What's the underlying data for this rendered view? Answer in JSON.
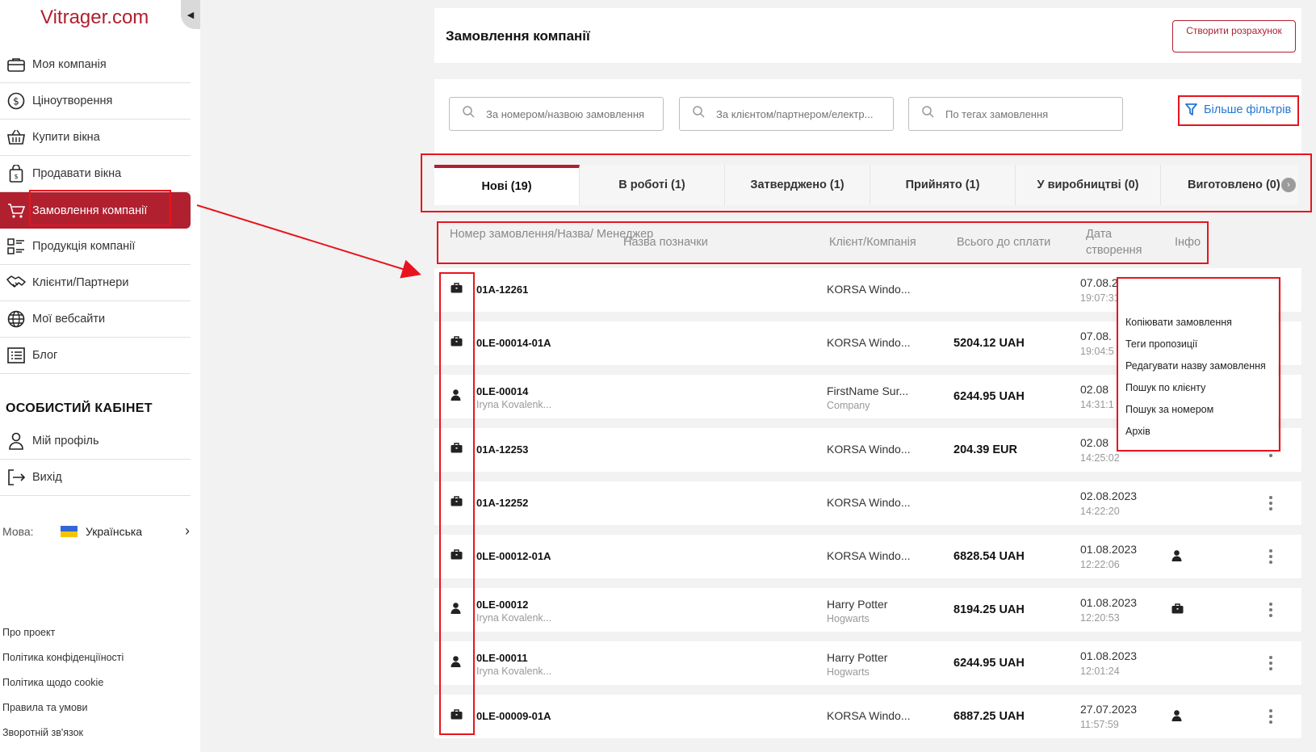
{
  "app": {
    "logo": "Vitrager.com"
  },
  "sidebar": {
    "items": [
      {
        "label": "Моя компанія",
        "icon": "briefcase-icon"
      },
      {
        "label": "Ціноутворення",
        "icon": "dollar-icon"
      },
      {
        "label": "Купити вікна",
        "icon": "basket-icon"
      },
      {
        "label": "Продавати вікна",
        "icon": "shopping-bag-icon"
      },
      {
        "label": "Замовлення компанії",
        "icon": "cart-icon",
        "active": true
      },
      {
        "label": "Продукція компанії",
        "icon": "list-icon"
      },
      {
        "label": "Клієнти/Партнери",
        "icon": "handshake-icon"
      },
      {
        "label": "Мої вебсайти",
        "icon": "globe-icon"
      },
      {
        "label": "Блог",
        "icon": "blog-icon"
      }
    ],
    "section_title": "ОСОБИСТИЙ КАБІНЕТ",
    "personal": [
      {
        "label": "Мій профіль",
        "icon": "user-icon"
      },
      {
        "label": "Вихід",
        "icon": "logout-icon"
      }
    ],
    "language": {
      "label": "Мова:",
      "value": "Українська"
    },
    "footer_links": [
      "Про проект",
      "Політика конфіденціїності",
      "Політика щодо cookie",
      "Правила та умови",
      "Зворотній зв'язок"
    ]
  },
  "header": {
    "title": "Замовлення компанії",
    "create_button": "Створити розрахунок"
  },
  "filters": {
    "search_order_placeholder": "За номером/назвою замовлення",
    "search_client_placeholder": "За клієнтом/партнером/електр...",
    "search_tags_placeholder": "По тегах замовлення",
    "more_filters": "Більше фільтрів"
  },
  "tabs": [
    {
      "label": "Нові (19)",
      "active": true
    },
    {
      "label": "В роботі (1)"
    },
    {
      "label": "Затверджено (1)"
    },
    {
      "label": "Прийнято (1)"
    },
    {
      "label": "У виробництві (0)"
    },
    {
      "label": "Виготовлено (0)"
    }
  ],
  "table": {
    "columns": {
      "number": "Номер замовлення/Назва/ Менеджер",
      "label": "Назва позначки",
      "client": "Клієнт/Компанія",
      "total": "Всього до сплати",
      "date": "Дата створення",
      "info": "Інфо"
    },
    "rows": [
      {
        "type": "briefcase",
        "number": "01A-12261",
        "manager": "",
        "client": "KORSA Windo...",
        "company": "",
        "total": "",
        "date": "07.08.2023",
        "time": "19:07:31",
        "info": ""
      },
      {
        "type": "briefcase",
        "number": "0LE-00014-01A",
        "manager": "",
        "client": "KORSA Windo...",
        "company": "",
        "total": "5204.12 UAH",
        "date": "07.08.",
        "time": "19:04:5",
        "info": ""
      },
      {
        "type": "person",
        "number": "0LE-00014",
        "manager": "Iryna Kovalenk...",
        "client": "FirstName Sur...",
        "company": "Company",
        "total": "6244.95 UAH",
        "date": "02.08",
        "time": "14:31:1",
        "info": ""
      },
      {
        "type": "briefcase",
        "number": "01A-12253",
        "manager": "",
        "client": "KORSA Windo...",
        "company": "",
        "total": "204.39 EUR",
        "date": "02.08",
        "time": "14:25:02",
        "info": ""
      },
      {
        "type": "briefcase",
        "number": "01A-12252",
        "manager": "",
        "client": "KORSA Windo...",
        "company": "",
        "total": "",
        "date": "02.08.2023",
        "time": "14:22:20",
        "info": ""
      },
      {
        "type": "briefcase",
        "number": "0LE-00012-01A",
        "manager": "",
        "client": "KORSA Windo...",
        "company": "",
        "total": "6828.54 UAH",
        "date": "01.08.2023",
        "time": "12:22:06",
        "info": "person"
      },
      {
        "type": "person",
        "number": "0LE-00012",
        "manager": "Iryna Kovalenk...",
        "client": "Harry Potter",
        "company": "Hogwarts",
        "total": "8194.25 UAH",
        "date": "01.08.2023",
        "time": "12:20:53",
        "info": "briefcase"
      },
      {
        "type": "person",
        "number": "0LE-00011",
        "manager": "Iryna Kovalenk...",
        "client": "Harry Potter",
        "company": "Hogwarts",
        "total": "6244.95 UAH",
        "date": "01.08.2023",
        "time": "12:01:24",
        "info": ""
      },
      {
        "type": "briefcase",
        "number": "0LE-00009-01A",
        "manager": "",
        "client": "KORSA Windo...",
        "company": "",
        "total": "6887.25 UAH",
        "date": "27.07.2023",
        "time": "11:57:59",
        "info": "person"
      }
    ]
  },
  "context_menu": {
    "items": [
      "Копіювати замовлення",
      "Теги пропозиції",
      "Редагувати назву замовлення",
      "Пошук по клієнту",
      "Пошук за номером",
      "Архів"
    ]
  },
  "colors": {
    "brand": "#b0202f",
    "annotation": "#e8141d",
    "link": "#2377d4"
  }
}
